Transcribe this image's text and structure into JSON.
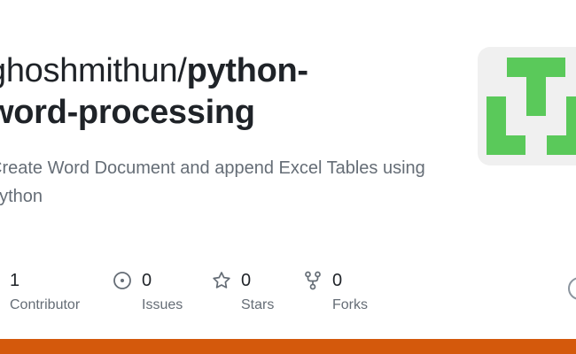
{
  "repo": {
    "owner": "ghoshmithun",
    "separator": "/",
    "name_part1": "python-",
    "name_part2": "word-processing",
    "description": "Create Word Document and append Excel Tables using python"
  },
  "stats": [
    {
      "count": "1",
      "label": "Contributor",
      "icon": "people-icon"
    },
    {
      "count": "0",
      "label": "Issues",
      "icon": "issue-opened-icon"
    },
    {
      "count": "0",
      "label": "Stars",
      "icon": "star-icon"
    },
    {
      "count": "0",
      "label": "Forks",
      "icon": "repo-forked-icon"
    }
  ],
  "colors": {
    "accent_bar": "#d4590c",
    "avatar_green": "#5ac95a",
    "avatar_bg": "#f0f0f0",
    "text_primary": "#1f2328",
    "text_muted": "#656d76"
  }
}
